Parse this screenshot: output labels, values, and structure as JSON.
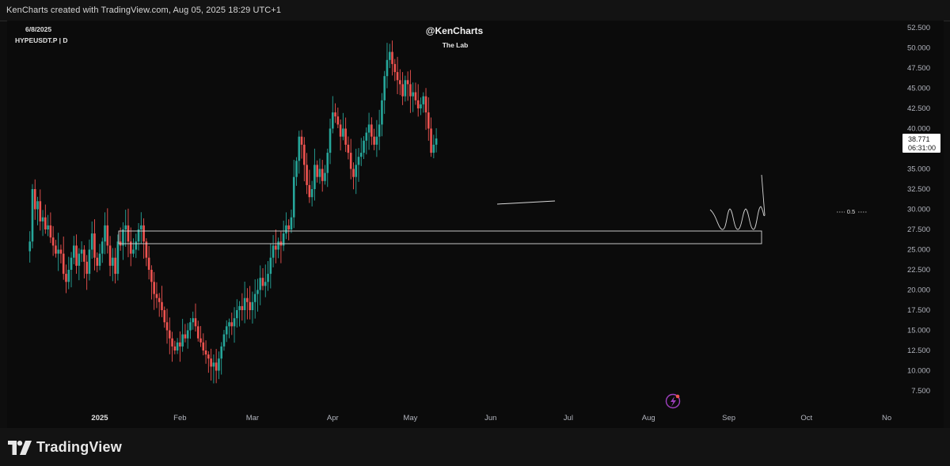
{
  "header": {
    "attribution": "KenCharts created with TradingView.com, Aug 05, 2025 18:29 UTC+1"
  },
  "chart_info": {
    "date": "6/8/2025",
    "symbol": "HYPEUSDT.P | D",
    "author": "@KenCharts",
    "subtitle": "The Lab"
  },
  "price_label": {
    "value": "38.771",
    "countdown": "06:31:00"
  },
  "fib_label": "0.5",
  "brand": {
    "name": "TradingView"
  },
  "colors": {
    "up": "#26a69a",
    "down": "#ef5350",
    "background": "#0b0b0b",
    "axis_text": "#b2b5be"
  },
  "chart_data": {
    "type": "candlestick",
    "y_axis": {
      "min": 7.5,
      "max": 52.5,
      "ticks": [
        "52.500",
        "50.000",
        "47.500",
        "45.000",
        "42.500",
        "40.000",
        "35.000",
        "32.500",
        "30.000",
        "27.500",
        "25.000",
        "22.500",
        "20.000",
        "17.500",
        "15.000",
        "12.500",
        "10.000",
        "7.500"
      ]
    },
    "x_axis": {
      "ticks": [
        {
          "label": "2025",
          "date": "2025-01-01",
          "bold": true
        },
        {
          "label": "Feb",
          "date": "2025-02-01"
        },
        {
          "label": "Mar",
          "date": "2025-03-01"
        },
        {
          "label": "Apr",
          "date": "2025-04-01"
        },
        {
          "label": "May",
          "date": "2025-05-01"
        },
        {
          "label": "Jun",
          "date": "2025-06-01"
        },
        {
          "label": "Jul",
          "date": "2025-07-01"
        },
        {
          "label": "Aug",
          "date": "2025-08-01"
        },
        {
          "label": "Sep",
          "date": "2025-09-01"
        },
        {
          "label": "Oct",
          "date": "2025-10-01"
        },
        {
          "label": "No",
          "date": "2025-11-01"
        }
      ]
    },
    "first_date": "2024-12-05",
    "last_price": 38.771,
    "closes": [
      26.0,
      32.5,
      30.0,
      31.0,
      28.5,
      29.0,
      27.5,
      28.0,
      26.5,
      25.5,
      24.5,
      25.0,
      24.5,
      22.0,
      21.0,
      22.5,
      24.0,
      25.5,
      23.0,
      24.5,
      25.0,
      23.5,
      22.0,
      25.0,
      27.0,
      24.0,
      23.0,
      24.5,
      26.0,
      28.0,
      25.5,
      23.0,
      24.0,
      22.0,
      26.0,
      25.5,
      27.5,
      28.0,
      26.0,
      24.5,
      25.0,
      26.0,
      27.5,
      28.0,
      26.0,
      24.0,
      22.5,
      21.0,
      19.5,
      19.0,
      18.5,
      17.5,
      16.0,
      15.0,
      14.0,
      13.0,
      12.5,
      13.5,
      13.0,
      14.5,
      14.0,
      15.0,
      16.0,
      16.5,
      15.5,
      14.0,
      13.5,
      12.5,
      12.0,
      11.5,
      10.5,
      11.0,
      10.0,
      11.5,
      13.0,
      14.5,
      15.5,
      16.0,
      15.5,
      16.5,
      17.5,
      18.0,
      17.5,
      19.0,
      18.5,
      17.5,
      18.5,
      19.5,
      20.0,
      21.5,
      20.5,
      21.0,
      22.0,
      24.0,
      25.5,
      25.0,
      26.0,
      25.5,
      27.0,
      28.0,
      27.5,
      29.0,
      34.0,
      36.0,
      39.0,
      38.0,
      35.5,
      33.0,
      31.5,
      32.5,
      35.5,
      34.0,
      35.0,
      33.5,
      34.5,
      37.0,
      40.0,
      42.0,
      41.5,
      40.5,
      39.0,
      40.0,
      38.0,
      37.0,
      35.0,
      34.0,
      35.5,
      36.5,
      37.0,
      38.5,
      39.5,
      40.5,
      39.0,
      38.0,
      39.0,
      40.5,
      43.5,
      46.5,
      48.5,
      49.5,
      48.0,
      47.0,
      46.0,
      45.5,
      44.0,
      46.0,
      45.5,
      44.0,
      44.5,
      43.5,
      42.5,
      43.0,
      44.0,
      42.0,
      40.0,
      37.0,
      38.0,
      38.771
    ]
  }
}
